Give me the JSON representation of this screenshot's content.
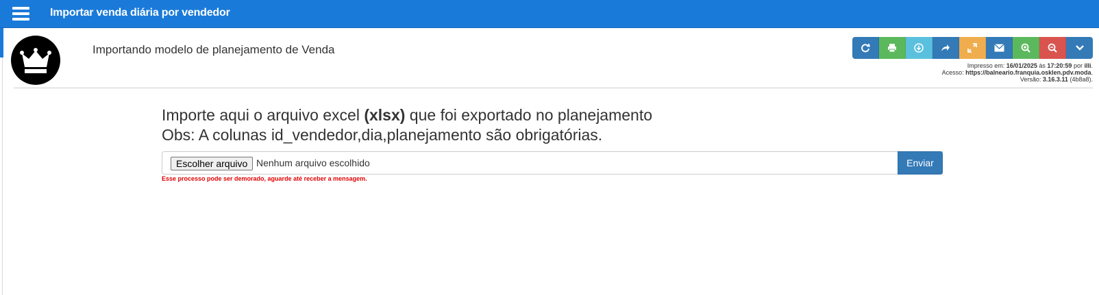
{
  "header": {
    "title": "Importar venda diária por vendedor",
    "menu_icon": "hamburger-menu-icon",
    "color": "#1a7ad9"
  },
  "page": {
    "logo_icon": "crown-icon",
    "heading": "Importando modelo de planejamento de Venda"
  },
  "toolbar": {
    "buttons": [
      {
        "icon": "refresh-icon",
        "color": "#337ab7"
      },
      {
        "icon": "print-icon",
        "color": "#5cb85c"
      },
      {
        "icon": "download-icon",
        "color": "#5bc0de"
      },
      {
        "icon": "share-icon",
        "color": "#337ab7"
      },
      {
        "icon": "fullscreen-icon",
        "color": "#f0ad4e"
      },
      {
        "icon": "email-icon",
        "color": "#337ab7"
      },
      {
        "icon": "zoom-in-icon",
        "color": "#5cb85c"
      },
      {
        "icon": "zoom-out-icon",
        "color": "#d9534f"
      },
      {
        "icon": "chevron-down-icon",
        "color": "#337ab7"
      }
    ]
  },
  "meta": {
    "printed_label": "Impresso em:",
    "printed_date": "16/01/2025",
    "at_label": "às",
    "printed_time": "17:20:59",
    "by_label": "por",
    "printed_user": "illi",
    "access_label": "Acesso:",
    "access_url": "https://balneario.franquia.osklen.pdv.moda",
    "version_label": "Versão:",
    "version": "3.16.3.11",
    "build": "(4b8a8)"
  },
  "main": {
    "intro_pre": "Importe aqui o arquivo excel ",
    "intro_bold": "(xlsx)",
    "intro_post": " que foi exportado no planejamento",
    "obs": "Obs: A colunas id_vendedor,dia,planejamento são obrigatórias.",
    "file_button": "Escolher arquivo",
    "file_status": "Nenhum arquivo escolhido",
    "send_button": "Enviar",
    "warning": "Esse processo pode ser demorado, aguarde até receber a mensagem."
  }
}
